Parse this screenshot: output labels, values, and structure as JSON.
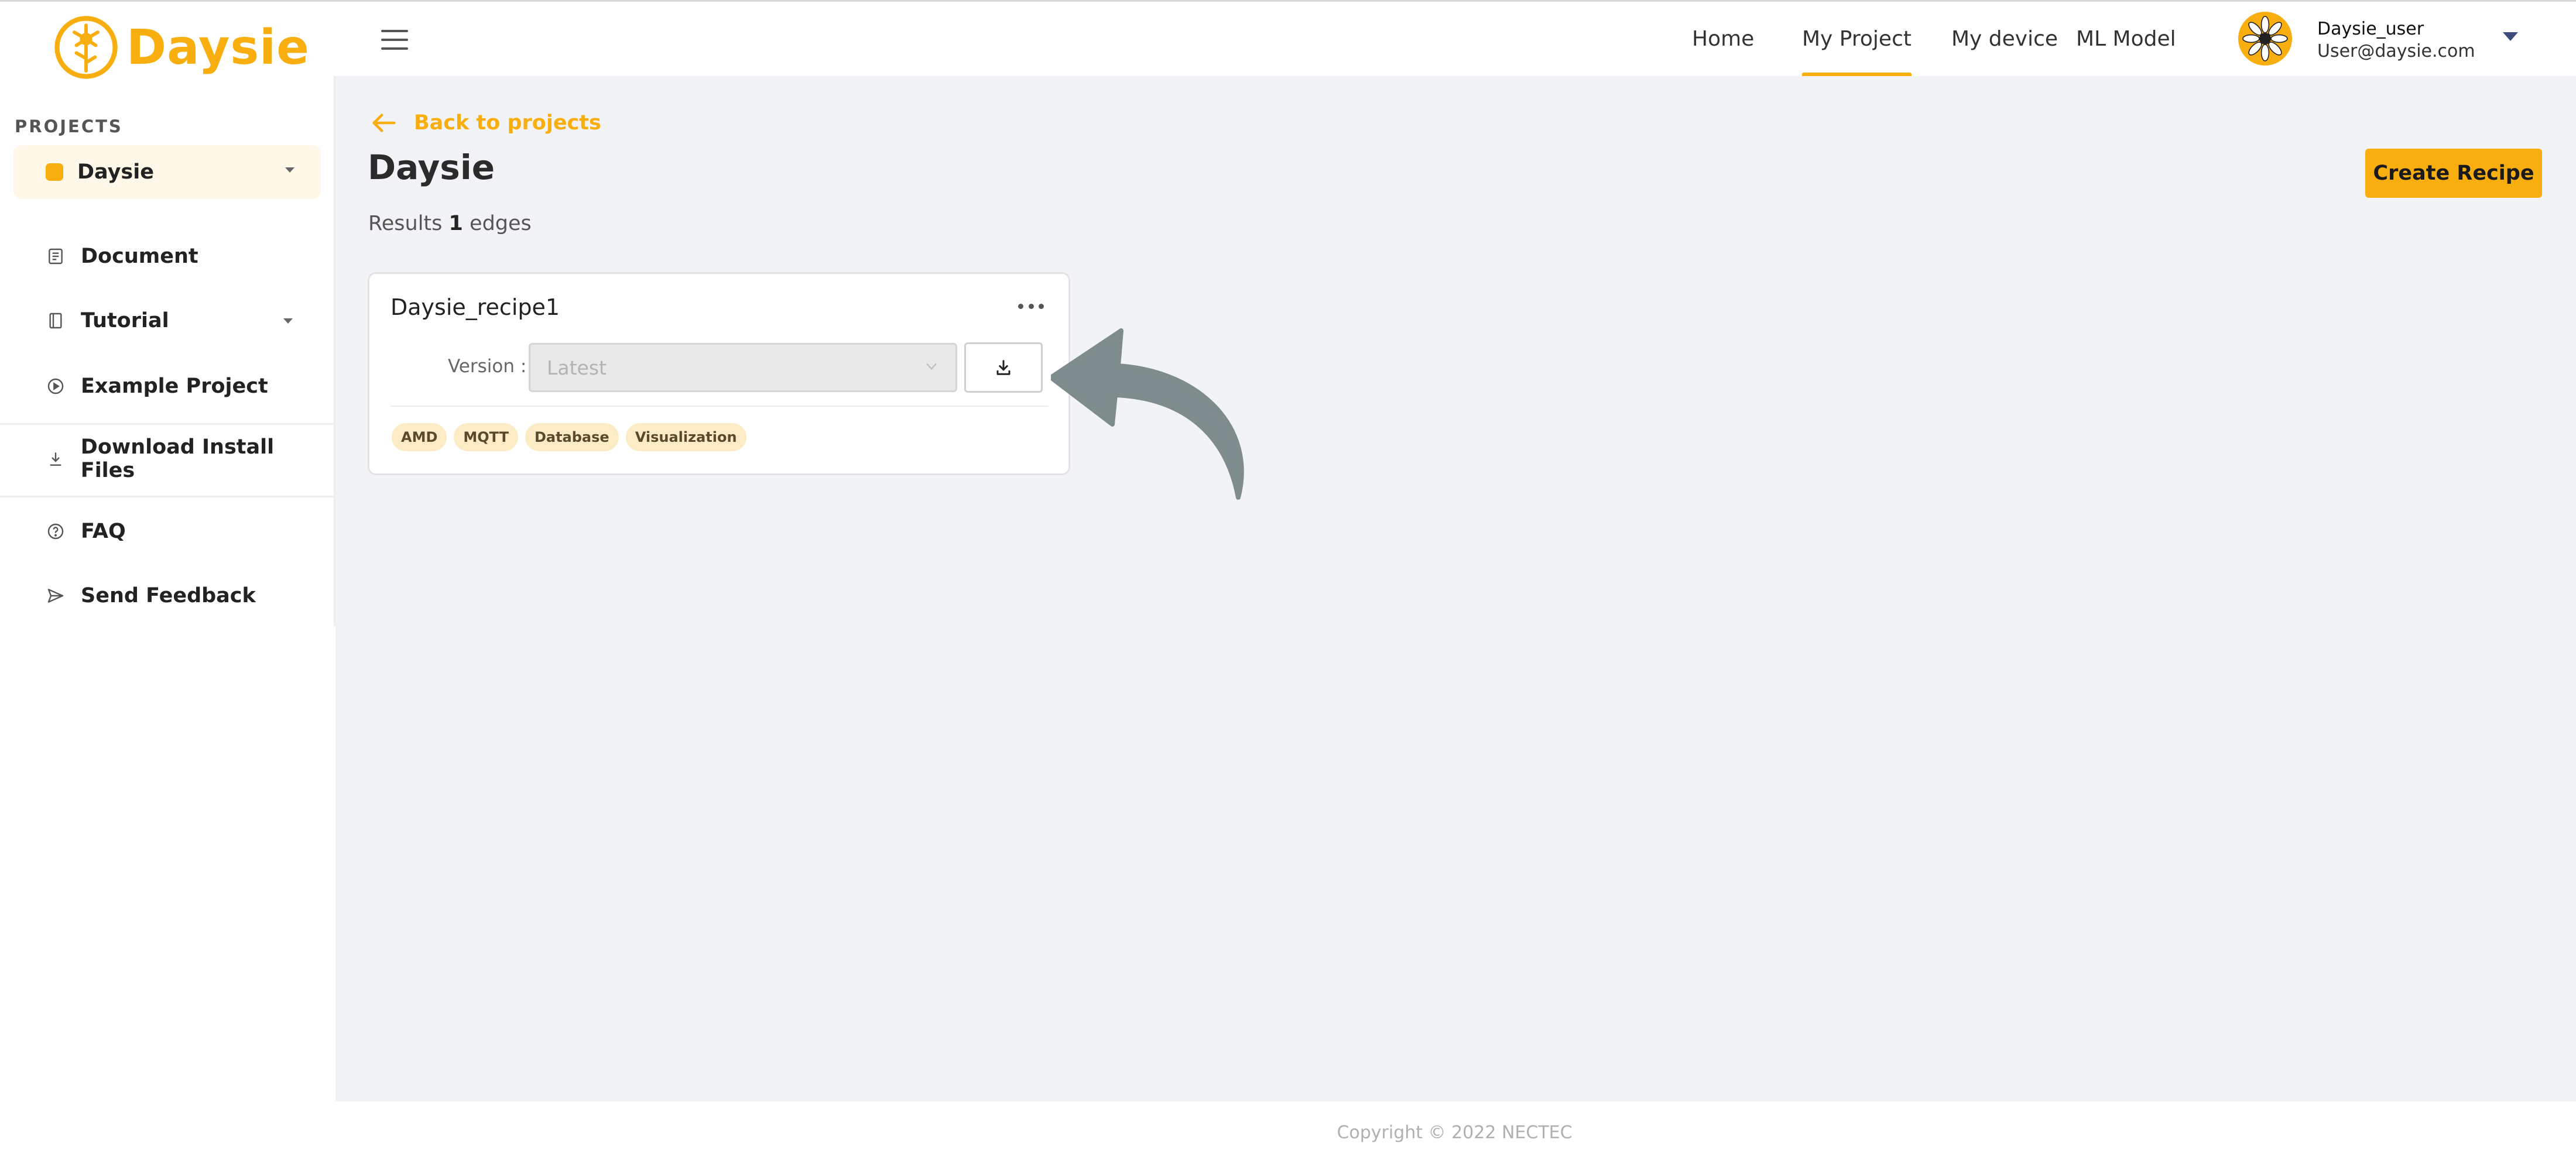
{
  "app": {
    "name": "Daysie"
  },
  "sidebar": {
    "section_label": "PROJECTS",
    "selected_project": "Daysie",
    "items": [
      {
        "label": "Document",
        "icon": "document-icon"
      },
      {
        "label": "Tutorial",
        "icon": "book-icon"
      },
      {
        "label": "Example Project",
        "icon": "play-circle-icon"
      },
      {
        "label": "Download Install Files",
        "icon": "download-icon"
      },
      {
        "label": "FAQ",
        "icon": "help-circle-icon"
      },
      {
        "label": "Send Feedback",
        "icon": "send-icon"
      }
    ]
  },
  "header": {
    "nav": [
      {
        "label": "Home"
      },
      {
        "label": "My Project",
        "active": true
      },
      {
        "label": "My device"
      },
      {
        "label": "ML Model"
      }
    ],
    "user": {
      "name": "Daysie_user",
      "email": "User@daysie.com"
    }
  },
  "main": {
    "back_label": "Back to projects",
    "title": "Daysie",
    "results_prefix": "Results",
    "results_count": "1",
    "results_suffix": "edges",
    "create_button": "Create Recipe",
    "card": {
      "title": "Daysie_recipe1",
      "version_label": "Version :",
      "version_placeholder": "Latest",
      "tags": [
        "AMD",
        "MQTT",
        "Database",
        "Visualization"
      ]
    }
  },
  "footer": {
    "copyright": "Copyright © 2022 NECTEC"
  },
  "colors": {
    "accent": "#f9ae10",
    "background": "#f2f3f7",
    "tag_bg": "#fcecc6",
    "arrow": "#7f8c8d"
  }
}
